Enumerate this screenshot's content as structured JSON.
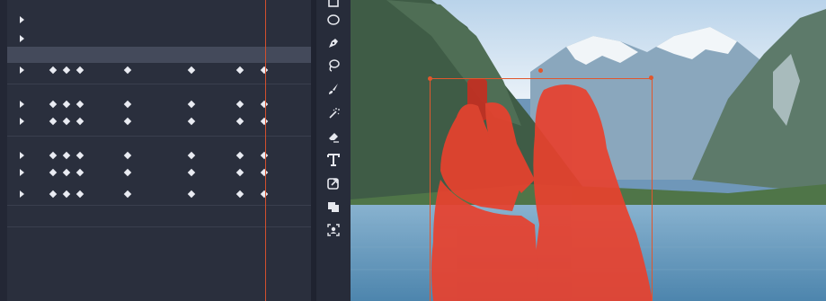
{
  "timeline": {
    "rows": [
      {
        "name": "track-row-1",
        "expandable": true,
        "selected": false,
        "keyframes": []
      },
      {
        "name": "track-row-2",
        "expandable": true,
        "selected": false,
        "keyframes": []
      },
      {
        "name": "track-row-selected",
        "expandable": false,
        "selected": true,
        "keyframes": []
      },
      {
        "name": "track-row-3",
        "expandable": true,
        "selected": false,
        "keyframes": [
          59,
          74,
          89,
          142,
          213,
          267,
          294
        ]
      },
      {
        "name": "track-row-4",
        "expandable": true,
        "selected": false,
        "keyframes": [
          59,
          74,
          89,
          142,
          213,
          267,
          294
        ]
      },
      {
        "name": "track-row-5",
        "expandable": true,
        "selected": false,
        "keyframes": [
          59,
          74,
          89,
          142,
          213,
          267,
          294
        ]
      },
      {
        "name": "track-row-6",
        "expandable": true,
        "selected": false,
        "keyframes": [
          59,
          74,
          89,
          142,
          213,
          267,
          294
        ]
      },
      {
        "name": "track-row-7",
        "expandable": true,
        "selected": false,
        "keyframes": [
          59,
          74,
          89,
          142,
          213,
          267,
          294
        ]
      },
      {
        "name": "track-row-8",
        "expandable": true,
        "selected": false,
        "keyframes": [
          59,
          74,
          89,
          142,
          213,
          267,
          294
        ]
      }
    ],
    "playhead_color": "#d3502e"
  },
  "tools": [
    {
      "name": "ellipse-tool",
      "icon": "ellipse-icon"
    },
    {
      "name": "pen-tool",
      "icon": "pen-icon"
    },
    {
      "name": "lasso-tool",
      "icon": "lasso-icon"
    },
    {
      "name": "brush-tool",
      "icon": "brush-icon"
    },
    {
      "name": "magic-wand-tool",
      "icon": "magic-wand-icon"
    },
    {
      "name": "eraser-tool",
      "icon": "eraser-icon"
    },
    {
      "name": "text-tool",
      "icon": "text-icon"
    },
    {
      "name": "export-tool",
      "icon": "export-icon"
    },
    {
      "name": "shapes-tool",
      "icon": "shapes-icon"
    },
    {
      "name": "person-select-tool",
      "icon": "person-select-icon"
    }
  ],
  "canvas": {
    "mask_color": "#e8412e",
    "selection_color": "#e0572d"
  }
}
